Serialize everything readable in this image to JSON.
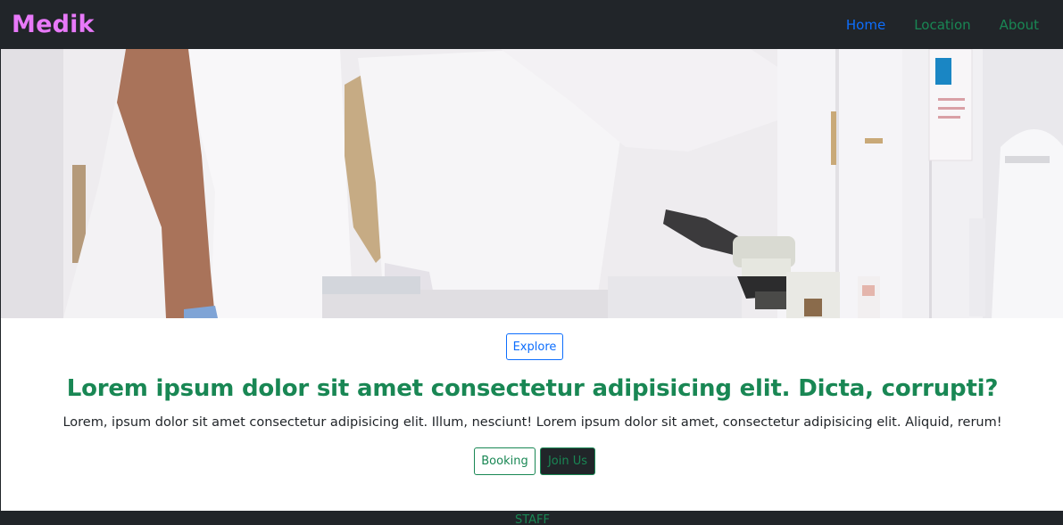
{
  "navbar": {
    "brand": "Medik",
    "links": [
      {
        "label": "Home",
        "active": true
      },
      {
        "label": "Location",
        "active": false
      },
      {
        "label": "About",
        "active": false
      }
    ]
  },
  "hero": {
    "image_alt": "Lab scientists in white coats beside a microscope"
  },
  "main": {
    "explore_label": "Explore",
    "headline": "Lorem ipsum dolor sit amet consectetur adipisicing elit. Dicta, corrupti?",
    "lead": "Lorem, ipsum dolor sit amet consectetur adipisicing elit. Illum, nesciunt! Lorem ipsum dolor sit amet, consectetur adipisicing elit. Aliquid, rerum!",
    "booking_label": "Booking",
    "join_label": "Join Us"
  },
  "footer": {
    "section_label": "STAFF"
  },
  "colors": {
    "navbar_bg": "#212529",
    "brand": "#e879f9",
    "primary": "#0d6efd",
    "success": "#198754"
  }
}
